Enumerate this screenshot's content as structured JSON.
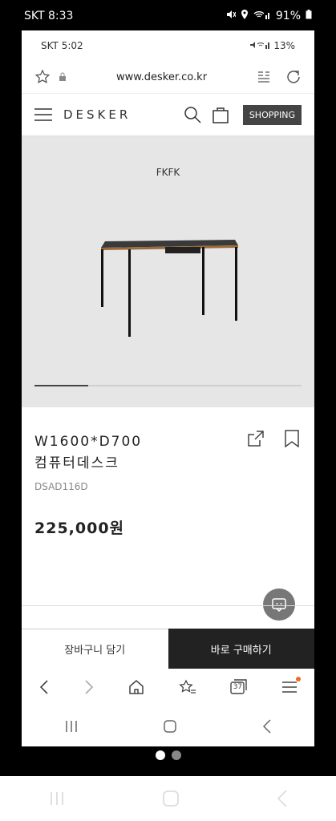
{
  "outer_status": {
    "carrier_time": "SKT 8:33",
    "battery": "91%"
  },
  "inner_status": {
    "carrier_time": "SKT 5:02",
    "battery": "13%"
  },
  "browser": {
    "url": "www.desker.co.kr"
  },
  "header": {
    "logo": "DESKER",
    "shopping_label": "SHOPPING"
  },
  "hero": {
    "brand": "FKFK",
    "progress": 0.2
  },
  "product": {
    "title_line1": "W1600*D700",
    "title_line2": "컴퓨터데스크",
    "code": "DSAD116D",
    "price": "225,000원"
  },
  "cta": {
    "cart_label": "장바구니 담기",
    "buy_label": "바로 구매하기"
  },
  "browser_nav": {
    "tabs_count": "37"
  },
  "pager": {
    "active_index": 0,
    "count": 2
  },
  "colors": {
    "accent_dark": "#222222",
    "notification_dot": "#f26a1b"
  }
}
